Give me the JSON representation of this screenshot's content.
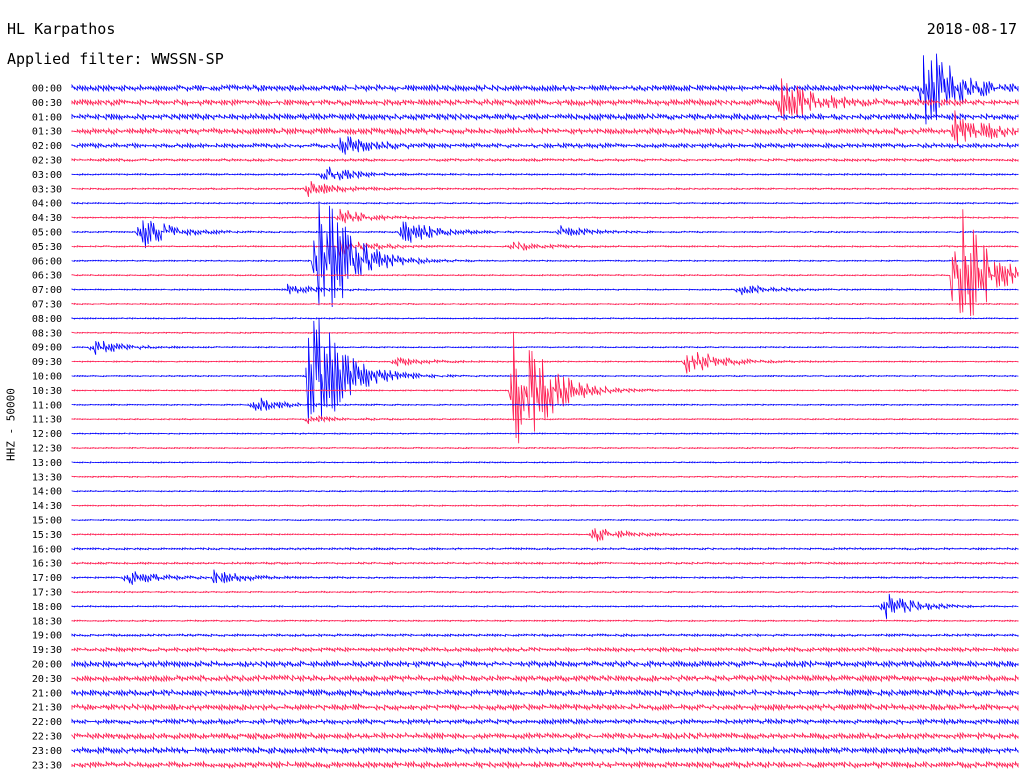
{
  "header": {
    "station": "HL Karpathos",
    "date": "2018-08-17",
    "filter": "Applied filter: WWSSN-SP"
  },
  "chart_data": {
    "type": "line",
    "title": "HL Karpathos",
    "ylabel": "HHZ - 50000",
    "colors": [
      "#0000ff",
      "#ff1a4f"
    ],
    "rows": [
      "00:00",
      "00:30",
      "01:00",
      "01:30",
      "02:00",
      "02:30",
      "03:00",
      "03:30",
      "04:00",
      "04:30",
      "05:00",
      "05:30",
      "06:00",
      "06:30",
      "07:00",
      "07:30",
      "08:00",
      "08:30",
      "09:00",
      "09:30",
      "10:00",
      "10:30",
      "11:00",
      "11:30",
      "12:00",
      "12:30",
      "13:00",
      "13:30",
      "14:00",
      "14:30",
      "15:00",
      "15:30",
      "16:00",
      "16:30",
      "17:00",
      "17:30",
      "18:00",
      "18:30",
      "19:00",
      "19:30",
      "20:00",
      "20:30",
      "21:00",
      "21:30",
      "22:00",
      "22:30",
      "23:00",
      "23:30"
    ],
    "noise": [
      3.0,
      3.0,
      3.0,
      3.0,
      2.2,
      1.3,
      0.8,
      0.8,
      0.7,
      0.7,
      0.7,
      0.7,
      0.6,
      0.6,
      0.6,
      0.6,
      0.6,
      0.6,
      0.6,
      0.6,
      0.6,
      0.6,
      0.6,
      0.6,
      0.6,
      0.6,
      0.6,
      0.6,
      0.6,
      0.6,
      0.6,
      0.6,
      1.0,
      1.0,
      0.8,
      0.7,
      0.7,
      0.7,
      1.2,
      2.0,
      3.0,
      3.0,
      3.0,
      3.0,
      2.5,
      3.0,
      3.0,
      3.0
    ],
    "events": [
      {
        "row": 0,
        "minute": 27.0,
        "amp": 50
      },
      {
        "row": 1,
        "minute": 22.5,
        "amp": 25
      },
      {
        "row": 3,
        "minute": 28.0,
        "amp": 18
      },
      {
        "row": 4,
        "minute": 8.5,
        "amp": 10
      },
      {
        "row": 6,
        "minute": 8.0,
        "amp": 9
      },
      {
        "row": 7,
        "minute": 7.5,
        "amp": 8
      },
      {
        "row": 9,
        "minute": 8.5,
        "amp": 9
      },
      {
        "row": 10,
        "minute": 2.2,
        "amp": 18
      },
      {
        "row": 10,
        "minute": 10.5,
        "amp": 14
      },
      {
        "row": 10,
        "minute": 15.5,
        "amp": 6
      },
      {
        "row": 11,
        "minute": 8.5,
        "amp": 10
      },
      {
        "row": 11,
        "minute": 14.0,
        "amp": 6
      },
      {
        "row": 14,
        "minute": 6.8,
        "amp": 6
      },
      {
        "row": 14,
        "minute": 21.2,
        "amp": 6
      },
      {
        "row": 18,
        "minute": 0.7,
        "amp": 8
      },
      {
        "row": 19,
        "minute": 10.2,
        "amp": 5
      },
      {
        "row": 19,
        "minute": 19.5,
        "amp": 16
      },
      {
        "row": 20,
        "minute": 7.5,
        "amp": 6
      },
      {
        "row": 22,
        "minute": 5.8,
        "amp": 8
      },
      {
        "row": 23,
        "minute": 7.5,
        "amp": 5
      },
      {
        "row": 31,
        "minute": 16.5,
        "amp": 9
      },
      {
        "row": 34,
        "minute": 1.8,
        "amp": 8
      },
      {
        "row": 34,
        "minute": 4.5,
        "amp": 8
      },
      {
        "row": 36,
        "minute": 25.8,
        "amp": 14
      },
      {
        "row": 12,
        "minute": 7.8,
        "amp": 90
      },
      {
        "row": 13,
        "minute": 28.0,
        "amp": 90
      },
      {
        "row": 20,
        "minute": 7.5,
        "amp": 90
      },
      {
        "row": 21,
        "minute": 14.0,
        "amp": 90
      }
    ]
  }
}
